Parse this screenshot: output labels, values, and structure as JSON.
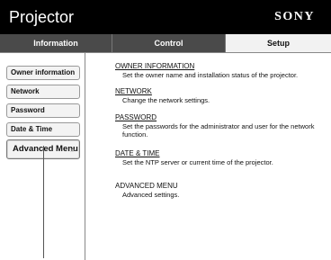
{
  "header": {
    "title": "Projector",
    "brand": "SONY"
  },
  "tabs": [
    {
      "label": "Information"
    },
    {
      "label": "Control"
    },
    {
      "label": "Setup"
    }
  ],
  "sidebar": {
    "items": [
      {
        "label": "Owner information"
      },
      {
        "label": "Network"
      },
      {
        "label": "Password"
      },
      {
        "label": "Date & Time"
      },
      {
        "label": "Advanced Menu",
        "chevron": "»"
      }
    ]
  },
  "content": {
    "items": [
      {
        "title": "OWNER INFORMATION",
        "description": "Set the owner name and installation status of the projector."
      },
      {
        "title": "NETWORK",
        "description": "Change the network settings."
      },
      {
        "title": "PASSWORD",
        "description": "Set the passwords for the administrator and user for the network function."
      },
      {
        "title": "DATE & TIME",
        "description": "Set the NTP server or current time of the projector."
      },
      {
        "title": "ADVANCED MENU",
        "description": "Advanced settings."
      }
    ]
  },
  "colors": {
    "topbar": "#000000",
    "tab_inactive": "#4a4a4a",
    "tab_active": "#f2f2f2"
  }
}
